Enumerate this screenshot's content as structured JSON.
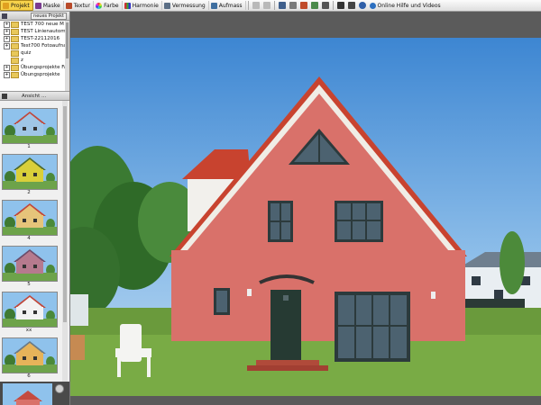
{
  "toolbar": {
    "items": [
      {
        "label": "Projekt",
        "icon": "folder-icon",
        "active": true
      },
      {
        "label": "Maske",
        "icon": "mask-icon"
      },
      {
        "label": "Textur",
        "icon": "texture-icon"
      },
      {
        "label": "Farbe",
        "icon": "color-wheel-icon"
      },
      {
        "label": "Harmonie",
        "icon": "harmony-icon"
      },
      {
        "label": "Vermessung",
        "icon": "measure-icon"
      },
      {
        "label": "Aufmass",
        "icon": "takeoff-icon"
      }
    ],
    "help_label": "Online Hilfe und Videos"
  },
  "project_panel": {
    "new_project_label": "neues Projekt",
    "tree": [
      "TEST 700 neue M",
      "TEST Linienautom",
      "TEST-22112016",
      "Test700 Fotoaufna",
      "quiz",
      "z",
      "Übungsprojekte Fa",
      "Übungsprojekte"
    ]
  },
  "view_panel": {
    "title": "Ansicht ...",
    "thumbnails": [
      {
        "label": "1",
        "wall": "#9fc6e6",
        "roof": "#c1473a"
      },
      {
        "label": "2",
        "wall": "#d9cf3a",
        "roof": "#4f6b2e"
      },
      {
        "label": "4",
        "wall": "#e6c47a",
        "roof": "#c1473a"
      },
      {
        "label": "5",
        "wall": "#b67a8e",
        "roof": "#6b4d6b"
      },
      {
        "label": "xx",
        "wall": "#f2f2f2",
        "roof": "#c1473a"
      },
      {
        "label": "6",
        "wall": "#e6b35a",
        "roof": "#6a7a86"
      }
    ]
  },
  "colors": {
    "house_wall": "#d9716a",
    "roof_tile": "#c8432f",
    "sky_top": "#3c86d4",
    "grass": "#6a9a3c",
    "toolbar_active": "#f7d24a"
  }
}
